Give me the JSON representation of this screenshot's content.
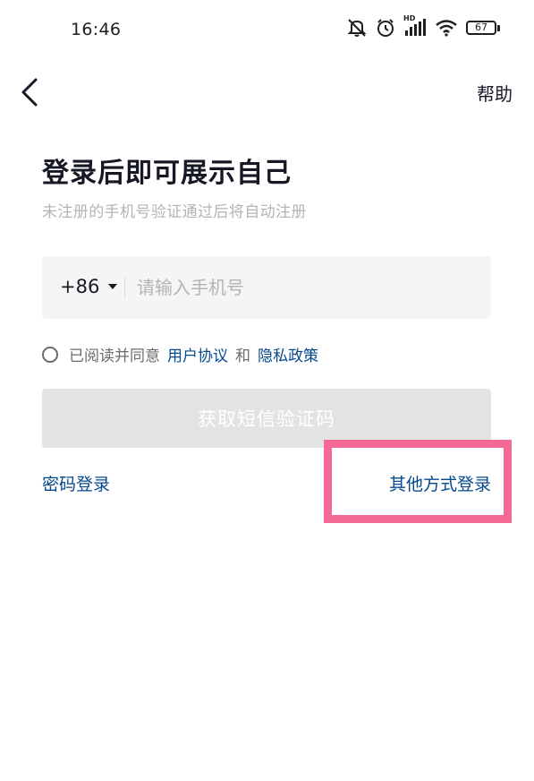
{
  "status_bar": {
    "time": "16:46",
    "network_label": "HD",
    "battery_level": "67"
  },
  "header": {
    "back_icon": "chevron-left-icon",
    "help_label": "帮助"
  },
  "main": {
    "title": "登录后即可展示自己",
    "subtitle": "未注册的手机号验证通过后将自动注册",
    "phone": {
      "country_code": "+86",
      "placeholder": "请输入手机号",
      "value": ""
    },
    "agreement": {
      "prefix": "已阅读并同意",
      "user_agreement": "用户协议",
      "conjunction": "和",
      "privacy_policy": "隐私政策",
      "checked": false
    },
    "sms_button_label": "获取短信验证码",
    "password_login_label": "密码登录",
    "other_login_label": "其他方式登录"
  },
  "colors": {
    "link": "#04498d",
    "highlight": "#f56a94",
    "disabled_button": "#e3e3e4"
  }
}
